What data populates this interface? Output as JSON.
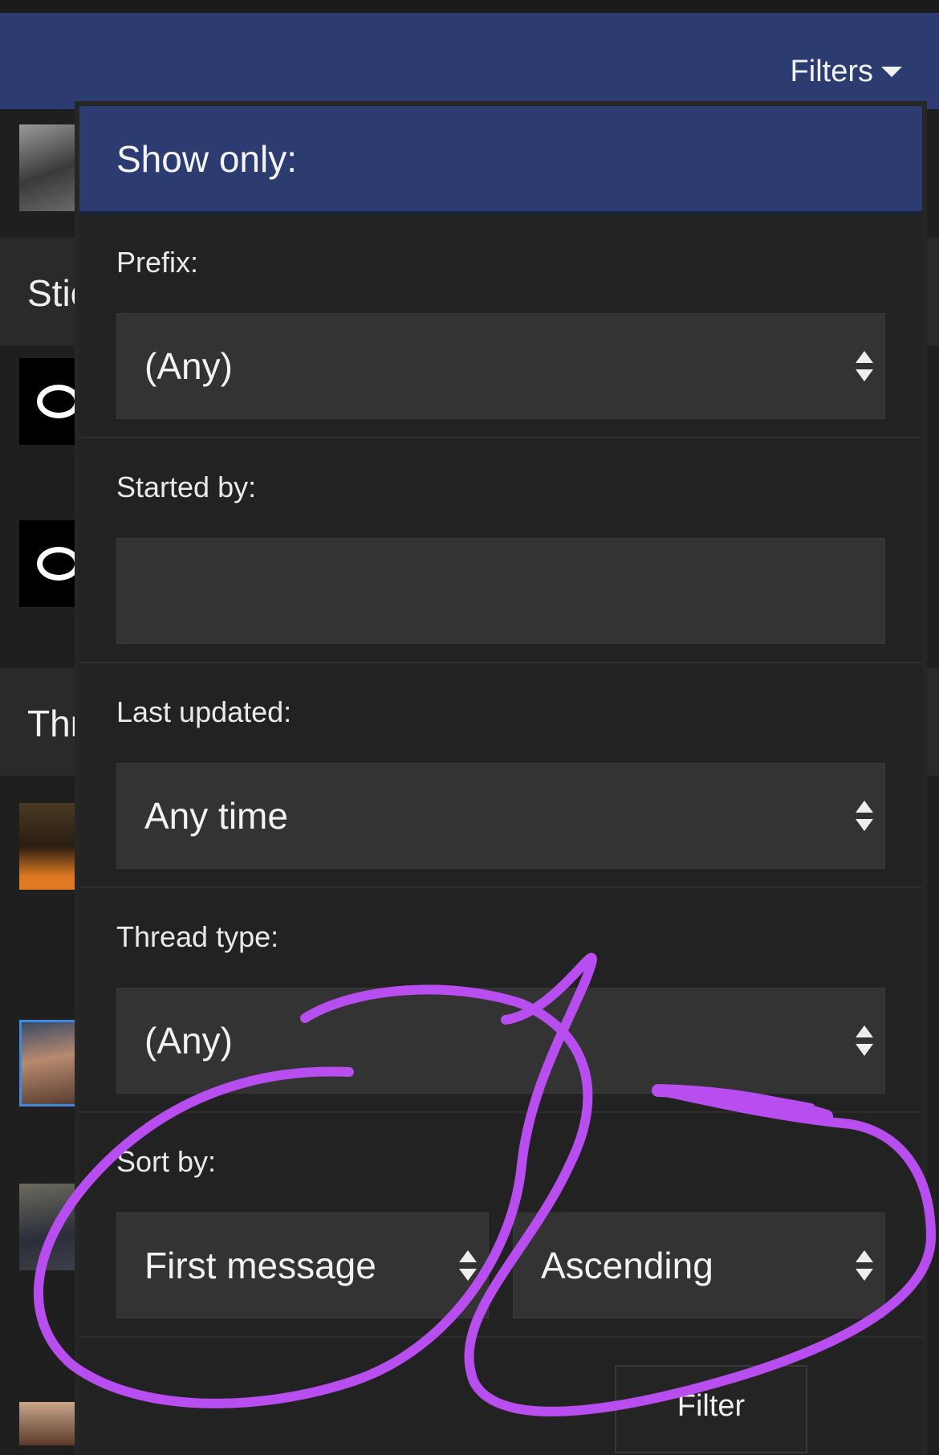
{
  "header": {
    "filters_label": "Filters"
  },
  "background": {
    "sticky_header": "Stic",
    "threads_header": "Thr"
  },
  "panel": {
    "title": "Show only:",
    "prefix": {
      "label": "Prefix:",
      "value": "(Any)"
    },
    "started_by": {
      "label": "Started by:",
      "value": ""
    },
    "last_updated": {
      "label": "Last updated:",
      "value": "Any time"
    },
    "thread_type": {
      "label": "Thread type:",
      "value": "(Any)"
    },
    "sort_by": {
      "label": "Sort by:",
      "field": "First message",
      "direction": "Ascending"
    },
    "filter_button": "Filter"
  },
  "colors": {
    "nav": "#2c3b70",
    "annotation": "#b84ef0"
  }
}
